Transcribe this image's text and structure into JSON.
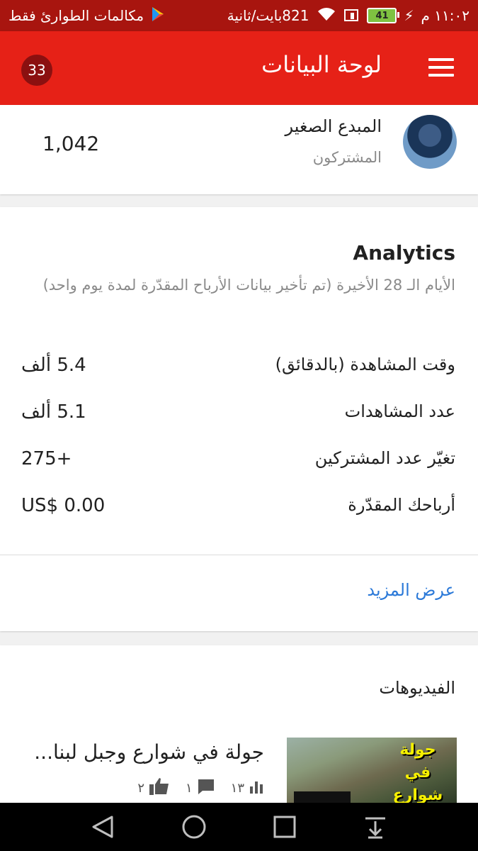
{
  "status_bar": {
    "carrier": "مكالمات الطوارئ فقط",
    "speed": "821بايت/ثانية",
    "battery": "41",
    "time": "١١:٠٢ م"
  },
  "app_bar": {
    "title": "لوحة البيانات",
    "notification_count": "33"
  },
  "channel": {
    "name": "المبدع الصغير",
    "subscribers_label": "المشتركون",
    "subscribers_count": "1,042"
  },
  "analytics": {
    "title": "Analytics",
    "subtitle": "الأيام الـ 28 الأخيرة (تم تأخير بيانات الأرباح المقدّرة لمدة يوم واحد)",
    "metrics": [
      {
        "label": "وقت المشاهدة (بالدقائق)",
        "value": "5.4 ألف"
      },
      {
        "label": "عدد المشاهدات",
        "value": "5.1 ألف"
      },
      {
        "label": "تغيّر عدد المشتركين",
        "value": "+275"
      },
      {
        "label": "أرباحك المقدّرة",
        "value": "US$ 0.00"
      }
    ],
    "more_link": "عرض المزيد"
  },
  "videos": {
    "title": "الفيديوهات",
    "items": [
      {
        "title": "جولة في شوارع وجبل لبنا...",
        "views": "١٣",
        "comments": "١",
        "likes": "٢",
        "thumbnail_text": "جولة في شوارع وجبل"
      }
    ]
  },
  "icons": [
    "menu-icon",
    "wifi-icon",
    "signal-icon",
    "battery-icon",
    "play-store-icon",
    "views-icon",
    "comment-icon",
    "like-icon",
    "back-icon",
    "home-icon",
    "recents-icon",
    "notification-down-icon"
  ],
  "colors": {
    "app_bar": "#e62117",
    "status_bar": "#a8150f",
    "link": "#2b79d8",
    "badge": "#8b1010"
  }
}
